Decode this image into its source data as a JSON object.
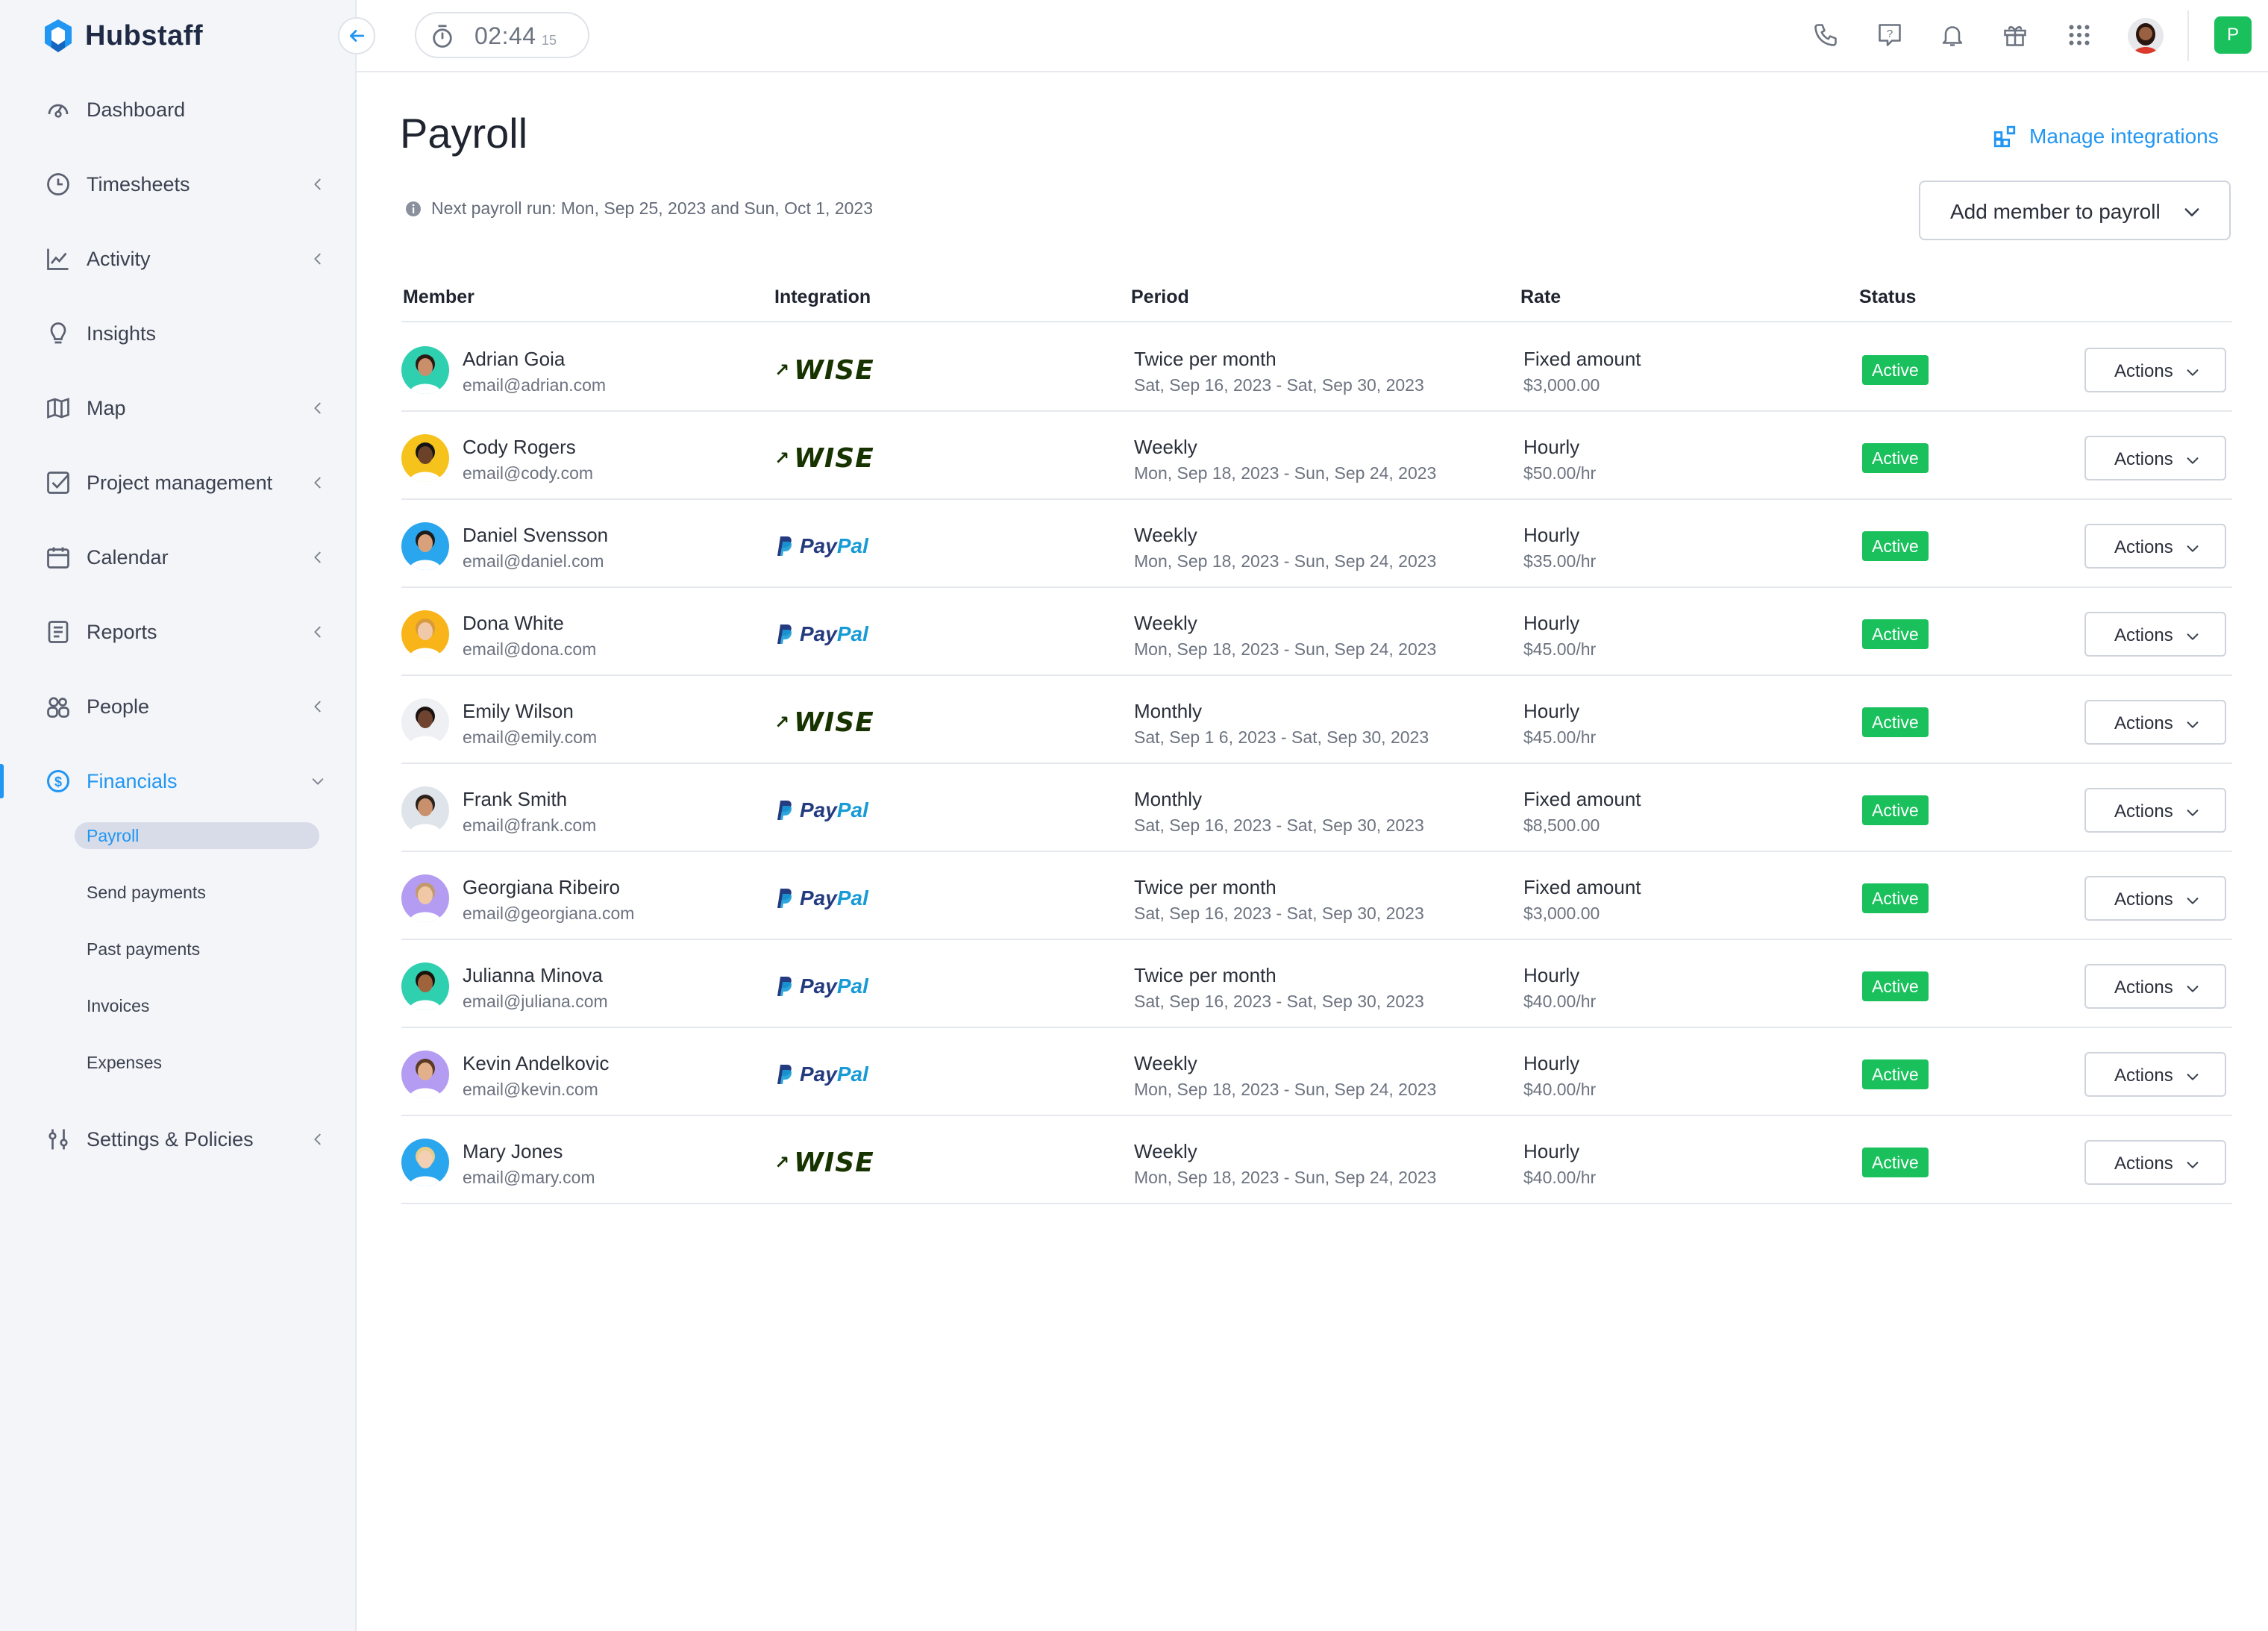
{
  "app": {
    "name": "Hubstaff"
  },
  "sidebar": {
    "items": [
      {
        "label": "Dashboard",
        "icon": "dashboard-icon",
        "chevron": false
      },
      {
        "label": "Timesheets",
        "icon": "clock-icon",
        "chevron": true
      },
      {
        "label": "Activity",
        "icon": "activity-chart-icon",
        "chevron": true
      },
      {
        "label": "Insights",
        "icon": "lightbulb-icon",
        "chevron": false
      },
      {
        "label": "Map",
        "icon": "map-icon",
        "chevron": true
      },
      {
        "label": "Project management",
        "icon": "checkbox-icon",
        "chevron": true
      },
      {
        "label": "Calendar",
        "icon": "calendar-icon",
        "chevron": true
      },
      {
        "label": "Reports",
        "icon": "report-icon",
        "chevron": true
      },
      {
        "label": "People",
        "icon": "people-icon",
        "chevron": true
      },
      {
        "label": "Financials",
        "icon": "dollar-circle-icon",
        "chevron": true,
        "active": true
      },
      {
        "label": "Settings & Policies",
        "icon": "sliders-icon",
        "chevron": true
      }
    ],
    "financials_sub": [
      "Payroll",
      "Send payments",
      "Past payments",
      "Invoices",
      "Expenses"
    ],
    "selected_sub": "Payroll"
  },
  "topbar": {
    "timer": {
      "time": "02:44",
      "seconds": "15"
    },
    "icons": [
      "phone-icon",
      "help-icon",
      "bell-icon",
      "gift-icon",
      "apps-grid-icon"
    ],
    "org_badge": "P"
  },
  "page": {
    "title": "Payroll",
    "manage_integrations": "Manage integrations",
    "next_run": "Next payroll run: Mon, Sep 25, 2023 and Sun, Oct 1, 2023",
    "add_member": "Add member to payroll"
  },
  "table": {
    "headers": {
      "member": "Member",
      "integration": "Integration",
      "period": "Period",
      "rate": "Rate",
      "status": "Status"
    },
    "actions_label": "Actions",
    "rows": [
      {
        "name": "Adrian Goia",
        "email": "email@adrian.com",
        "integration": "wise",
        "period": "Twice per month",
        "range": "Sat, Sep 16, 2023 - Sat, Sep 30, 2023",
        "rate_type": "Fixed amount",
        "rate": "$3,000.00",
        "status": "Active",
        "avatar_bg": "#2fd0b0",
        "skin": "#c98e6a",
        "hair": "#2b1a12"
      },
      {
        "name": "Cody Rogers",
        "email": "email@cody.com",
        "integration": "wise",
        "period": "Weekly",
        "range": "Mon, Sep 18, 2023 - Sun, Sep 24, 2023",
        "rate_type": "Hourly",
        "rate": "$50.00/hr",
        "status": "Active",
        "avatar_bg": "#f6c21c",
        "skin": "#6b4128",
        "hair": "#141414"
      },
      {
        "name": "Daniel Svensson",
        "email": "email@daniel.com",
        "integration": "paypal",
        "period": "Weekly",
        "range": "Mon, Sep 18, 2023 - Sun, Sep 24, 2023",
        "rate_type": "Hourly",
        "rate": "$35.00/hr",
        "status": "Active",
        "avatar_bg": "#2aa6ee",
        "skin": "#d9a07c",
        "hair": "#1c1c1c"
      },
      {
        "name": "Dona White",
        "email": "email@dona.com",
        "integration": "paypal",
        "period": "Weekly",
        "range": "Mon, Sep 18, 2023 - Sun, Sep 24, 2023",
        "rate_type": "Hourly",
        "rate": "$45.00/hr",
        "status": "Active",
        "avatar_bg": "#f8b418",
        "skin": "#f0c9a8",
        "hair": "#d89a3c"
      },
      {
        "name": "Emily Wilson",
        "email": "email@emily.com",
        "integration": "wise",
        "period": "Monthly",
        "range": "Sat, Sep 1  6, 2023 - Sat, Sep 30, 2023",
        "rate_type": "Hourly",
        "rate": "$45.00/hr",
        "status": "Active",
        "avatar_bg": "#eef0f3",
        "skin": "#6e4430",
        "hair": "#1a1210"
      },
      {
        "name": "Frank Smith",
        "email": "email@frank.com",
        "integration": "paypal",
        "period": "Monthly",
        "range": "Sat, Sep 16, 2023 - Sat, Sep 30, 2023",
        "rate_type": "Fixed amount",
        "rate": "$8,500.00",
        "status": "Active",
        "avatar_bg": "#dfe4ea",
        "skin": "#c8906c",
        "hair": "#2a211a"
      },
      {
        "name": "Georgiana Ribeiro",
        "email": "email@georgiana.com",
        "integration": "paypal",
        "period": "Twice per month",
        "range": "Sat, Sep 16, 2023 - Sat, Sep 30, 2023",
        "rate_type": "Fixed amount",
        "rate": "$3,000.00",
        "status": "Active",
        "avatar_bg": "#b49cf2",
        "skin": "#f0c8a6",
        "hair": "#c29a6a"
      },
      {
        "name": "Julianna Minova",
        "email": "email@juliana.com",
        "integration": "paypal",
        "period": "Twice per month",
        "range": "Sat, Sep 16, 2023 - Sat, Sep 30, 2023",
        "rate_type": "Hourly",
        "rate": "$40.00/hr",
        "status": "Active",
        "avatar_bg": "#2fd0b0",
        "skin": "#a0643c",
        "hair": "#1a120c"
      },
      {
        "name": "Kevin Andelkovic",
        "email": "email@kevin.com",
        "integration": "paypal",
        "period": "Weekly",
        "range": "Mon, Sep 18, 2023 - Sun, Sep 24, 2023",
        "rate_type": "Hourly",
        "rate": "$40.00/hr",
        "status": "Active",
        "avatar_bg": "#b49cf2",
        "skin": "#e3b08c",
        "hair": "#5a3a22"
      },
      {
        "name": "Mary Jones",
        "email": "email@mary.com",
        "integration": "wise",
        "period": "Weekly",
        "range": "Mon, Sep 18, 2023 - Sun, Sep 24, 2023",
        "rate_type": "Hourly",
        "rate": "$40.00/hr",
        "status": "Active",
        "avatar_bg": "#2aa6ee",
        "skin": "#f3d0b4",
        "hair": "#e8cc8a"
      }
    ]
  },
  "colors": {
    "accent": "#2196f3",
    "active_status": "#19c05c",
    "wise": "#163300",
    "paypal_dark": "#253b80",
    "paypal_light": "#179bd7"
  },
  "integration_names": {
    "wise": "WISE",
    "paypal_pay": "Pay",
    "paypal_pal": "Pal"
  }
}
